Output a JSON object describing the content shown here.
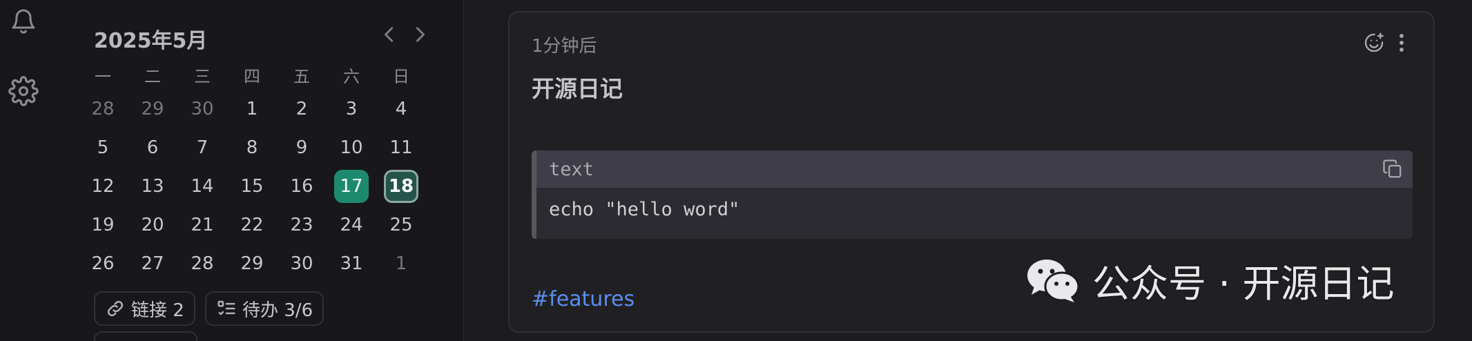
{
  "calendar": {
    "month_title": "2025年5月",
    "weekdays": [
      "一",
      "二",
      "三",
      "四",
      "五",
      "六",
      "日"
    ],
    "weeks": [
      [
        "28",
        "29",
        "30",
        "1",
        "2",
        "3",
        "4"
      ],
      [
        "5",
        "6",
        "7",
        "8",
        "9",
        "10",
        "11"
      ],
      [
        "12",
        "13",
        "14",
        "15",
        "16",
        "17",
        "18"
      ],
      [
        "19",
        "20",
        "21",
        "22",
        "23",
        "24",
        "25"
      ],
      [
        "26",
        "27",
        "28",
        "29",
        "30",
        "31",
        "1"
      ]
    ],
    "selected_day": "17",
    "today_day": "18"
  },
  "chips": {
    "links_label": "链接 2",
    "todo_label": "待办 3/6"
  },
  "memo": {
    "time": "1分钟后",
    "title": "开源日记",
    "code_language": "text",
    "code_content": "echo \"hello word\"",
    "tag": "#features"
  },
  "watermark": {
    "text": "公众号 · 开源日记"
  },
  "colors": {
    "accent_selected": "#1e8a6d",
    "accent_today": "#24544a",
    "tag": "#5b8def"
  },
  "icons": [
    "bell-icon",
    "gear-icon",
    "chevron-left-icon",
    "chevron-right-icon",
    "link-icon",
    "checklist-icon",
    "emoji-add-icon",
    "more-vertical-icon",
    "copy-icon",
    "wechat-icon"
  ]
}
